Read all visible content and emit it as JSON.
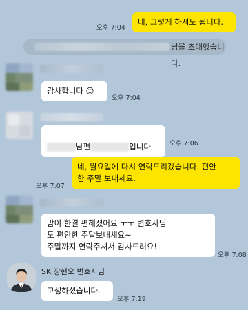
{
  "messages": {
    "m1": {
      "text": "네, 그렇게 하셔도 됩니다.",
      "time": "오후 7:04"
    },
    "notice": {
      "text": "님을 초대했습니다."
    },
    "m2": {
      "text": "감사합니다 ☺",
      "time": "오후 7:04"
    },
    "m3": {
      "part1": "남편",
      "part2": "입니다",
      "time": "오후 7:06"
    },
    "m4": {
      "text": "네, 월요일에 다시 연락드리겠습니다. 편안\n한 주말 보내세요.",
      "time": "오후 7:07"
    },
    "m5": {
      "text": "맘이 한결  편해졌어요  ㅜㅜ  변호사님\n도  편안한 주말보내세요~\n주말까지  연락주셔서  감사드려요!",
      "time": "오후 7:08"
    },
    "m6": {
      "sender": "SK 장현오 변호사님",
      "text": "고생하셨습니다.",
      "time": "오후 7:19"
    }
  },
  "colors": {
    "background": "#b2c7da",
    "my_bubble": "#fee500",
    "their_bubble": "#ffffff"
  }
}
